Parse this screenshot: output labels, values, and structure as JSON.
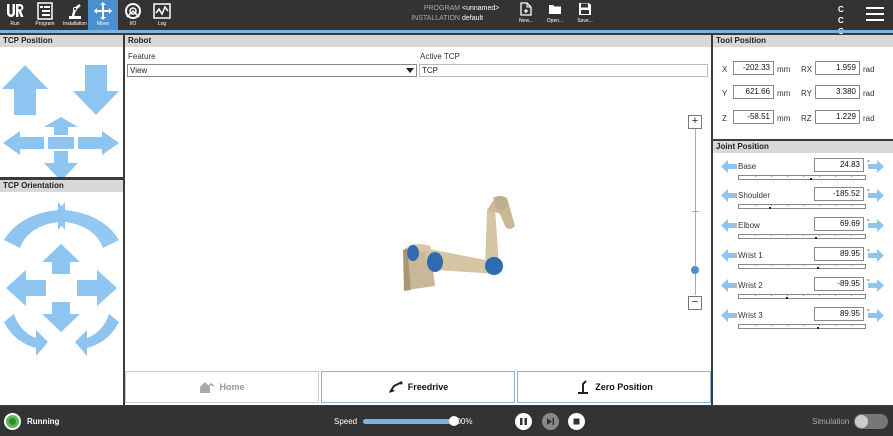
{
  "nav": {
    "run": "Run",
    "program": "Program",
    "installation": "Installation",
    "move": "Move",
    "io": "I/O",
    "log": "Log"
  },
  "header": {
    "program_label": "PROGRAM",
    "installation_label": "INSTALLATION",
    "program_value": "<unnamed>",
    "installation_value": "default",
    "new": "New...",
    "open": "Open...",
    "save": "Save...",
    "cc_top": "C C",
    "cc_bottom": "C C"
  },
  "tcp_position": {
    "title": "TCP Position"
  },
  "tcp_orientation": {
    "title": "TCP Orientation"
  },
  "robot": {
    "title": "Robot",
    "feature_label": "Feature",
    "feature_value": "View",
    "active_tcp_label": "Active TCP",
    "active_tcp_value": "TCP",
    "zoom_in": "+",
    "zoom_out": "−"
  },
  "tool_position": {
    "title": "Tool Position",
    "x_label": "X",
    "x_value": "-202.33",
    "x_unit": "mm",
    "y_label": "Y",
    "y_value": "621.66",
    "y_unit": "mm",
    "z_label": "Z",
    "z_value": "-58.51",
    "z_unit": "mm",
    "rx_label": "RX",
    "rx_value": "1.959",
    "rx_unit": "rad",
    "ry_label": "RY",
    "ry_value": "3.380",
    "ry_unit": "rad",
    "rz_label": "RZ",
    "rz_value": "1.229",
    "rz_unit": "rad"
  },
  "joint_position": {
    "title": "Joint Position",
    "unit": "°",
    "joints": [
      {
        "name": "Base",
        "value": "24.83",
        "fraction": 0.57
      },
      {
        "name": "Shoulder",
        "value": "-185.52",
        "fraction": 0.24
      },
      {
        "name": "Elbow",
        "value": "69.69",
        "fraction": 0.61
      },
      {
        "name": "Wrist 1",
        "value": "89.95",
        "fraction": 0.63
      },
      {
        "name": "Wrist 2",
        "value": "-89.95",
        "fraction": 0.38
      },
      {
        "name": "Wrist 3",
        "value": "89.95",
        "fraction": 0.63
      }
    ]
  },
  "buttons": {
    "home": "Home",
    "freedrive": "Freedrive",
    "zero_position": "Zero Position"
  },
  "status": {
    "running": "Running",
    "speed_label": "Speed",
    "speed_value": "100%",
    "speed_fraction": 1.0,
    "simulation": "Simulation"
  },
  "colors": {
    "accent": "#7fb3dc",
    "arrow": "#8ec5f0",
    "running": "#5cb85c"
  }
}
